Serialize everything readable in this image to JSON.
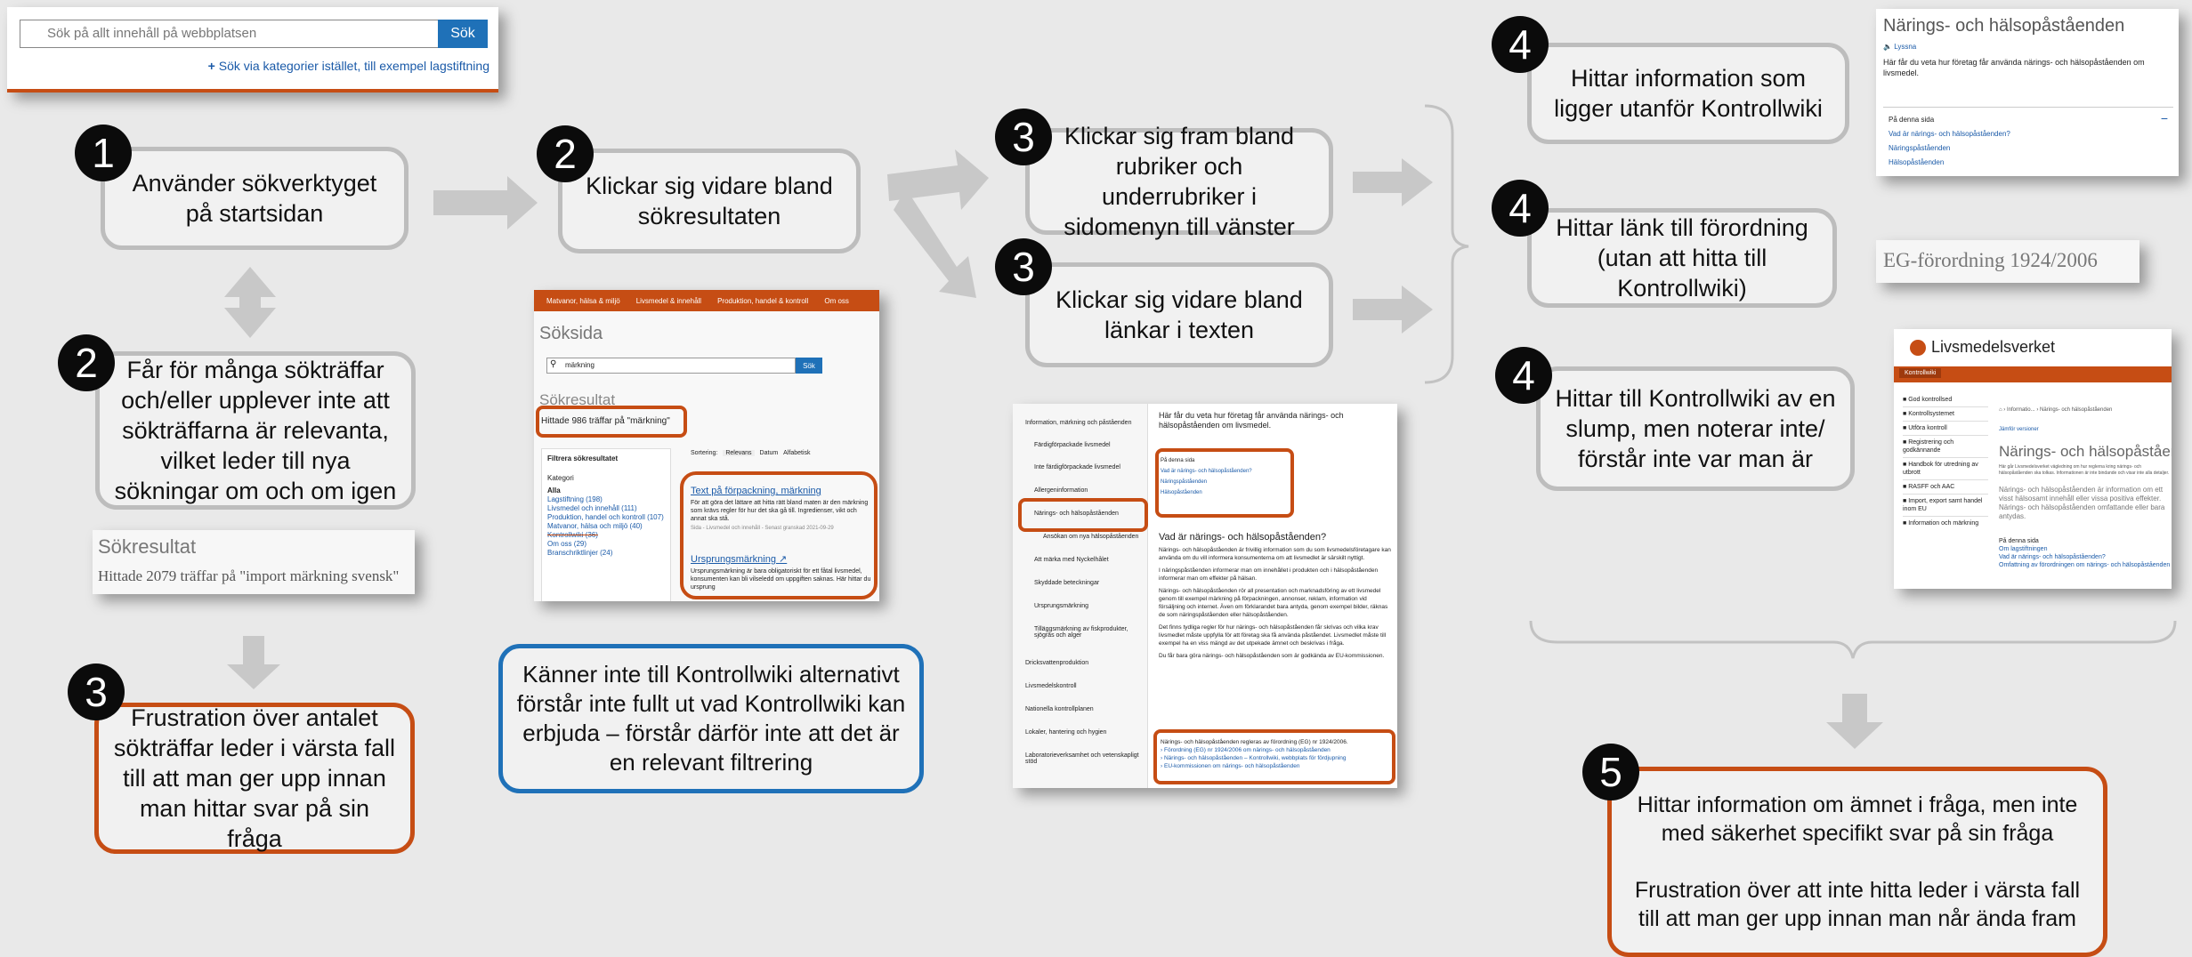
{
  "search_widget": {
    "placeholder": "Sök på allt innehåll på webbplatsen",
    "button": "Sök",
    "category_link": "Sök via kategorier istället, till exempel lagstiftning"
  },
  "steps": [
    {
      "num": "1",
      "text": "Använder sökverktyget på startsidan"
    },
    {
      "num": "2",
      "text": "Får för många sökträffar och/eller upplever inte att sökträffarna är relevanta, vilket leder till nya sökningar om och om igen"
    },
    {
      "num": "3",
      "text": "Frustration över antalet sökträffar leder i värsta fall till att man ger upp innan man hittar svar på sin fråga"
    },
    {
      "num": "2",
      "text": "Klickar sig vidare bland sökresultaten"
    },
    {
      "num": "",
      "text": "Känner inte till Kontrollwiki alternativt förstår inte fullt ut vad Kontrollwiki kan erbjuda – förstår därför inte att det är en relevant filtrering"
    },
    {
      "num": "3",
      "text": "Klickar sig fram bland rubriker och underrubriker i sidomenyn till vänster"
    },
    {
      "num": "3",
      "text": "Klickar sig vidare bland länkar i texten"
    },
    {
      "num": "4",
      "text": "Hittar information som ligger utanför Kontrollwiki"
    },
    {
      "num": "4",
      "text": "Hittar länk till förordning (utan att hitta till Kontrollwiki)"
    },
    {
      "num": "4",
      "text": "Hittar till Kontrollwiki av en slump, men noterar inte/ förstår inte var man är"
    },
    {
      "num": "5",
      "text": "Hittar information om ämnet i fråga, men inte med säkerhet specifikt svar på sin fråga\n\nFrustration över att inte hitta leder i värsta fall till att man ger upp innan man når ända fram"
    }
  ],
  "results_snippet": {
    "title": "Sökresultat",
    "count": "Hittade 2079 träffar på \"import märkning svensk\""
  },
  "search_page": {
    "nav": [
      "Matvanor, hälsa & miljö",
      "Livsmedel & innehåll",
      "Produktion, handel & kontroll",
      "Om oss"
    ],
    "title": "Söksida",
    "query": "märkning",
    "button": "Sök",
    "results_heading": "Sökresultat",
    "hits": "Hittade 986 träffar på \"märkning\"",
    "filter_title": "Filtrera sökresultatet",
    "category_label": "Kategori",
    "categories": [
      "Alla",
      "Lagstiftning (198)",
      "Livsmedel och innehåll (111)",
      "Produktion, handel och kontroll (107)",
      "Matvanor, hälsa och miljö (40)",
      "Kontrollwiki (36)",
      "Om oss (29)",
      "Branschriktlinjer (24)"
    ],
    "sort_label": "Sortering:",
    "sort_options": [
      "Relevans",
      "Datum",
      "Alfabetisk"
    ],
    "result1_title": "Text på förpackning, märkning",
    "result1_text": "För att göra det lättare att hitta rätt bland maten är den märkning som krävs regler för hur det ska gå till. Ingredienser, vikt och annat ska stå.",
    "result1_meta": "Sida - Livsmedel och innehåll - Senast granskad 2021-09-29",
    "result2_title": "Ursprungsmärkning",
    "result2_text": "Ursprungsmärkning är bara obligatoriskt för ett fåtal livsmedel, konsumenten kan bli vilseledd om uppgiften saknas. Här hittar du ursprung"
  },
  "article_page": {
    "sidebar": [
      "Information, märkning och påståenden",
      "Färdigförpackade livsmedel",
      "Inte färdigförpackade livsmedel",
      "Allergeninformation",
      "Närings- och hälsopåståenden",
      "Ansökan om nya hälsopåståenden",
      "Att märka med Nyckelhålet",
      "Skyddade beteckningar",
      "Ursprungsmärkning",
      "Tilläggsmärkning av fiskprodukter, sjögräs och alger",
      "Dricksvattenproduktion",
      "Livsmedelskontroll",
      "Nationella kontrollplanen",
      "Lokaler, hantering och hygien",
      "Laboratorieverksamhet och vetenskapligt stöd"
    ],
    "intro": "Här får du veta hur företag får använda närings- och hälsopåståenden om livsmedel.",
    "toc_title": "På denna sida",
    "toc": [
      "Vad är närings- och hälsopåståenden?",
      "Näringspåståenden",
      "Hälsopåståenden"
    ],
    "heading": "Vad är närings- och hälsopåståenden?",
    "p1": "Närings- och hälsopåståenden är frivillig information som du som livsmedelsföretagare kan använda om du vill informera konsumenterna om att livsmedlet är särskilt nyttigt.",
    "p2": "I näringspåståenden informerar man om innehållet i produkten och i hälsopåståenden informerar man om effekter på hälsan.",
    "p3": "Närings- och hälsopåståenden rör all presentation och marknadsföring av ett livsmedel genom till exempel märkning på förpackningen, annonser, reklam, information vid försäljning och internet. Även om förklarandet bara antyda, genom exempel bilder, räknas de som näringspåståenden eller hälsopåståenden.",
    "p4": "Det finns tydliga regler för hur närings- och hälsopåståenden får skrivas och vilka krav livsmedlet måste uppfylla för att företag ska få använda påståendet. Livsmedlet måste till exempel ha en viss mängd av det utpekade ämnet och beskrivas i fråga.",
    "p5": "Du får bara göra närings- och hälsopåståenden som är godkända av EU-kommissionen.",
    "law_text": "Närings- och hälsopåståenden regleras av förordning (EG) nr 1924/2006.",
    "law_links": [
      "Förordning (EG) nr 1924/2006 om närings- och hälsopåståenden",
      "Närings- och hälsopåståenden – Kontrollwiki, webbplats för fördjupning",
      "EU-kommissionen om närings- och hälsopåståenden"
    ]
  },
  "external_page": {
    "title": "Närings- och hälsopåståenden",
    "listen": "Lyssna",
    "intro": "Här får du veta hur företag får använda närings- och hälsopåståenden om livsmedel.",
    "toc_title": "På denna sida",
    "toc": [
      "Vad är närings- och hälsopåståenden?",
      "Näringspåståenden",
      "Hälsopåståenden"
    ]
  },
  "regulation_snippet": {
    "title": "EG-förordning 1924/2006"
  },
  "kontrollwiki_page": {
    "brand": "Livsmedelsverket",
    "tab": "Kontrollwiki",
    "sidebar": [
      "God kontrollsed",
      "Kontrollsystemet",
      "Utföra kontroll",
      "Registrering och godkännande",
      "Handbok för utredning av utbrott",
      "RASFF och AAC",
      "Import, export samt handel inom EU",
      "Information och märkning"
    ],
    "breadcrumb": "Informatio...  ›  Närings- och hälsopåståenden",
    "versions": "Jämför versioner",
    "title": "Närings- och hälsopåståenden",
    "intro_small": "Här går Livsmedelsverket vägledning om hur reglerna kring närings- och hälsopåståenden ska tolkas. Informationen är inte bindande och visar inte alla detaljer.",
    "body": "Närings- och hälsopåståenden är information om ett visst hälsosamt innehåll eller vissa positiva effekter. Närings- och hälsopåståenden omfattande eller bara antydas.",
    "toc_title": "På denna sida",
    "toc": [
      "Om lagstiftningen",
      "Vad är närings- och hälsopåståenden?",
      "Omfattning av förordningen om närings- och hälsopåståenden"
    ]
  },
  "colors": {
    "orange": "#c64d14",
    "blue": "#1f71b8",
    "gray": "#bdbdbd",
    "arrow": "#c5c5c5"
  }
}
